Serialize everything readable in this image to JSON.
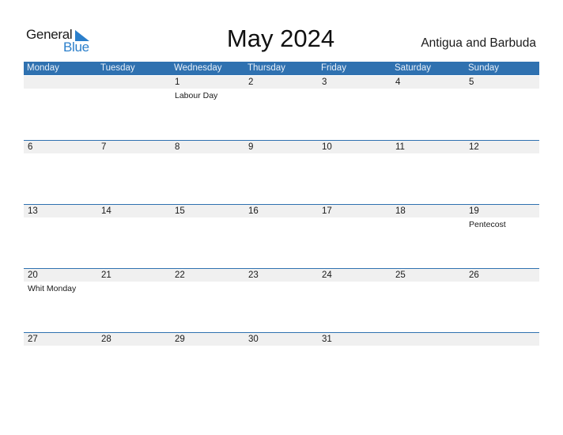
{
  "logo": {
    "line1": "General",
    "line2": "Blue"
  },
  "title": "May 2024",
  "country": "Antigua and Barbuda",
  "colors": {
    "header_bg": "#2F71B0",
    "date_strip": "#F0F0F0",
    "logo_blue": "#2B7FCB"
  },
  "weekdays": [
    "Monday",
    "Tuesday",
    "Wednesday",
    "Thursday",
    "Friday",
    "Saturday",
    "Sunday"
  ],
  "weeks": [
    {
      "days": [
        {
          "date": "",
          "event": ""
        },
        {
          "date": "",
          "event": ""
        },
        {
          "date": "1",
          "event": "Labour Day"
        },
        {
          "date": "2",
          "event": ""
        },
        {
          "date": "3",
          "event": ""
        },
        {
          "date": "4",
          "event": ""
        },
        {
          "date": "5",
          "event": ""
        }
      ]
    },
    {
      "days": [
        {
          "date": "6",
          "event": ""
        },
        {
          "date": "7",
          "event": ""
        },
        {
          "date": "8",
          "event": ""
        },
        {
          "date": "9",
          "event": ""
        },
        {
          "date": "10",
          "event": ""
        },
        {
          "date": "11",
          "event": ""
        },
        {
          "date": "12",
          "event": ""
        }
      ]
    },
    {
      "days": [
        {
          "date": "13",
          "event": ""
        },
        {
          "date": "14",
          "event": ""
        },
        {
          "date": "15",
          "event": ""
        },
        {
          "date": "16",
          "event": ""
        },
        {
          "date": "17",
          "event": ""
        },
        {
          "date": "18",
          "event": ""
        },
        {
          "date": "19",
          "event": "Pentecost"
        }
      ]
    },
    {
      "days": [
        {
          "date": "20",
          "event": "Whit Monday"
        },
        {
          "date": "21",
          "event": ""
        },
        {
          "date": "22",
          "event": ""
        },
        {
          "date": "23",
          "event": ""
        },
        {
          "date": "24",
          "event": ""
        },
        {
          "date": "25",
          "event": ""
        },
        {
          "date": "26",
          "event": ""
        }
      ]
    },
    {
      "days": [
        {
          "date": "27",
          "event": ""
        },
        {
          "date": "28",
          "event": ""
        },
        {
          "date": "29",
          "event": ""
        },
        {
          "date": "30",
          "event": ""
        },
        {
          "date": "31",
          "event": ""
        },
        {
          "date": "",
          "event": ""
        },
        {
          "date": "",
          "event": ""
        }
      ]
    }
  ]
}
